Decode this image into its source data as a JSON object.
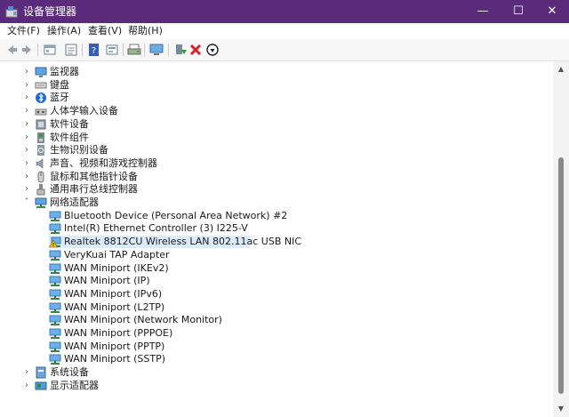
{
  "window": {
    "title": "设备管理器",
    "minimize_icon": "minimize-icon",
    "maximize_icon": "maximize-icon",
    "close_icon": "close-icon"
  },
  "menu": [
    "文件(F)",
    "操作(A)",
    "查看(V)",
    "帮助(H)"
  ],
  "toolbar": [
    "back-icon",
    "forward-icon",
    "properties-icon",
    "view-icon",
    "help-icon",
    "resources-icon",
    "print-icon",
    "scan-hardware-icon",
    "update-driver-icon",
    "uninstall-icon",
    "disable-icon"
  ],
  "tree": {
    "categories_top": [
      "监视器",
      "键盘",
      "蓝牙",
      "人体学输入设备",
      "软件设备",
      "软件组件",
      "生物识别设备",
      "声音、视频和游戏控制器",
      "鼠标和其他指针设备",
      "通用串行总线控制器"
    ],
    "network": {
      "label": "网络适配器",
      "children": [
        "Bluetooth Device (Personal Area Network) #2",
        "Intel(R) Ethernet Controller (3) I225-V",
        "Realtek 8812CU Wireless LAN 802.11ac USB NIC",
        "VeryKuai TAP Adapter",
        "WAN Miniport (IKEv2)",
        "WAN Miniport (IP)",
        "WAN Miniport (IPv6)",
        "WAN Miniport (L2TP)",
        "WAN Miniport (Network Monitor)",
        "WAN Miniport (PPPOE)",
        "WAN Miniport (PPTP)",
        "WAN Miniport (SSTP)"
      ],
      "warning_item": 2
    },
    "categories_bottom": [
      "系统设备",
      "显示适配器"
    ]
  },
  "colors": {
    "titlebar": "#5a2b7a",
    "selection": "#dcebfc",
    "warning": "#f2c200"
  }
}
